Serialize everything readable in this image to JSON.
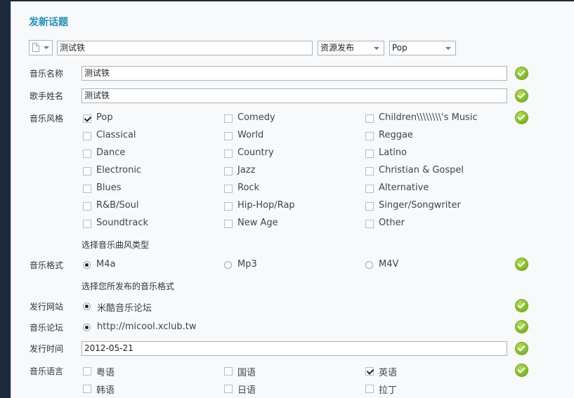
{
  "panel": {
    "title": "发新话题"
  },
  "topbar": {
    "subject_value": "测试铁",
    "category_select": "资源发布",
    "genre_select": "Pop"
  },
  "fields": {
    "music_name_label": "音乐名称",
    "music_name_value": "测试铁",
    "singer_label": "歌手姓名",
    "singer_value": "测试铁",
    "style_label": "音乐风格",
    "style_hint": "选择音乐曲风类型",
    "format_label": "音乐格式",
    "format_hint": "选择您所发布的音乐格式",
    "site_label": "发行网站",
    "site_option": "米酷音乐论坛",
    "forum_label": "音乐论坛",
    "forum_option": "http://micool.xclub.tw",
    "date_label": "发行时间",
    "date_value": "2012-05-21",
    "lang_label": "音乐语言"
  },
  "styles": [
    {
      "label": "Pop",
      "checked": true
    },
    {
      "label": "Comedy",
      "checked": false
    },
    {
      "label": "Children\\\\\\\\\\\\\\\\'s Music",
      "checked": false
    },
    {
      "label": "Classical",
      "checked": false
    },
    {
      "label": "World",
      "checked": false
    },
    {
      "label": "Reggae",
      "checked": false
    },
    {
      "label": "Dance",
      "checked": false
    },
    {
      "label": "Country",
      "checked": false
    },
    {
      "label": "Latino",
      "checked": false
    },
    {
      "label": "Electronic",
      "checked": false
    },
    {
      "label": "Jazz",
      "checked": false
    },
    {
      "label": "Christian & Gospel",
      "checked": false
    },
    {
      "label": "Blues",
      "checked": false
    },
    {
      "label": "Rock",
      "checked": false
    },
    {
      "label": "Alternative",
      "checked": false
    },
    {
      "label": "R&B/Soul",
      "checked": false
    },
    {
      "label": "Hip-Hop/Rap",
      "checked": false
    },
    {
      "label": "Singer/Songwriter",
      "checked": false
    },
    {
      "label": "Soundtrack",
      "checked": false
    },
    {
      "label": "New Age",
      "checked": false
    },
    {
      "label": "Other",
      "checked": false
    }
  ],
  "formats": [
    {
      "label": "M4a",
      "selected": true
    },
    {
      "label": "Mp3",
      "selected": false
    },
    {
      "label": "M4V",
      "selected": false
    }
  ],
  "languages": [
    {
      "label": "粤语",
      "checked": false
    },
    {
      "label": "国语",
      "checked": false
    },
    {
      "label": "英语",
      "checked": true
    },
    {
      "label": "韩语",
      "checked": false
    },
    {
      "label": "日语",
      "checked": false
    },
    {
      "label": "拉丁",
      "checked": false
    }
  ],
  "colors": {
    "title": "#1f8fbd",
    "valid_icon": "#82bb25",
    "background": "#1c2a3c"
  },
  "icons": {
    "valid": "check-circle-icon",
    "doc": "document-icon"
  }
}
